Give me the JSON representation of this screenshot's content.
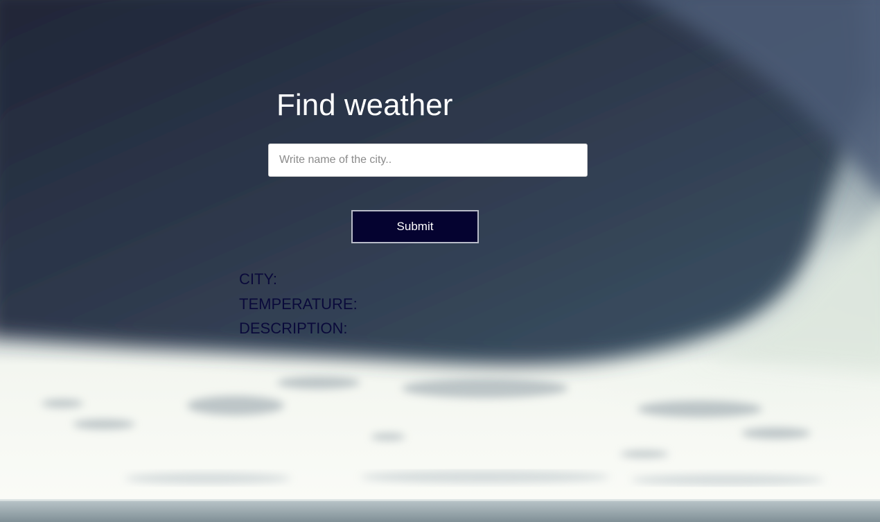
{
  "page": {
    "title": "Find weather"
  },
  "search": {
    "value": "",
    "placeholder": "Write name of the city.."
  },
  "actions": {
    "submit_label": "Submit"
  },
  "results": {
    "city_label": "CITY:",
    "temperature_label": "TEMPERATURE:",
    "description_label": "DESCRIPTION:"
  },
  "colors": {
    "button_bg": "#050330",
    "result_text": "#0a0a3a",
    "title_text": "#ffffff"
  }
}
